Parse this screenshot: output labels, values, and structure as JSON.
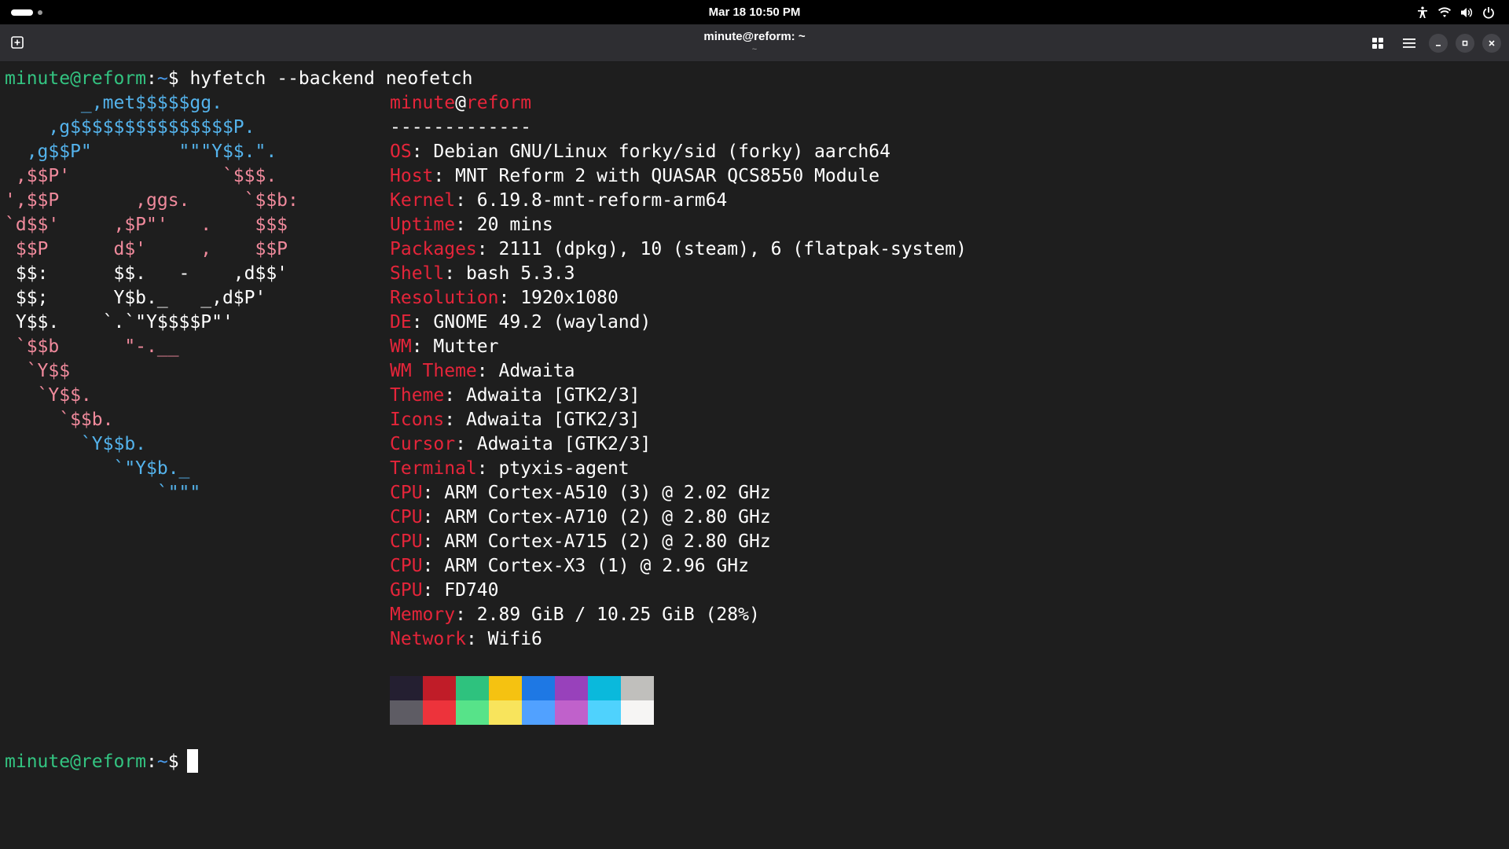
{
  "topbar": {
    "clock": "Mar 18  10:50 PM",
    "tray_icons": [
      "accessibility-icon",
      "wifi-icon",
      "volume-icon",
      "power-icon"
    ]
  },
  "headerbar": {
    "title": "minute@reform: ~",
    "subtitle": "~",
    "buttons": [
      "new-tab-icon",
      "tab-overview-icon",
      "menu-icon",
      "minimize-icon",
      "maximize-icon",
      "close-icon"
    ]
  },
  "terminal": {
    "prompt_user_host": "minute@reform",
    "prompt_colon": ":",
    "prompt_path": "~",
    "prompt_dollar": "$",
    "command": " hyfetch --backend neofetch",
    "ascii_art": [
      {
        "segs": [
          {
            "t": "       _,met$$$$$gg.",
            "c": "cyan"
          }
        ]
      },
      {
        "segs": [
          {
            "t": "    ,g$$$$$$$$$$$$$$$P.",
            "c": "cyan"
          }
        ]
      },
      {
        "segs": [
          {
            "t": "  ,g$$P\"        \"\"\"Y$$.\".",
            "c": "cyan"
          }
        ]
      },
      {
        "segs": [
          {
            "t": " ,$$P'              `$$$.",
            "c": "pink"
          }
        ]
      },
      {
        "segs": [
          {
            "t": "',$$P       ,ggs.     `$$b:",
            "c": "pink"
          }
        ]
      },
      {
        "segs": [
          {
            "t": "`d$$'     ,$P\"'   .    $$$",
            "c": "pink"
          }
        ]
      },
      {
        "segs": [
          {
            "t": " $$P      d$'     ,    $$P",
            "c": "pink"
          }
        ]
      },
      {
        "segs": [
          {
            "t": " $$:      $$.   -    ,d$$'",
            "c": "white"
          }
        ]
      },
      {
        "segs": [
          {
            "t": " $$;      Y$b._   _,d$P'",
            "c": "white"
          }
        ]
      },
      {
        "segs": [
          {
            "t": " Y$$.    `.`\"Y$$$$P\"'",
            "c": "white"
          }
        ]
      },
      {
        "segs": [
          {
            "t": " `$$b      \"-.__",
            "c": "pink"
          }
        ]
      },
      {
        "segs": [
          {
            "t": "  `Y$$",
            "c": "pink"
          }
        ]
      },
      {
        "segs": [
          {
            "t": "   `Y$$.",
            "c": "pink"
          }
        ]
      },
      {
        "segs": [
          {
            "t": "     `$$b.",
            "c": "pink"
          }
        ]
      },
      {
        "segs": [
          {
            "t": "       `Y$$b.",
            "c": "cyan"
          }
        ]
      },
      {
        "segs": [
          {
            "t": "          `\"Y$b._",
            "c": "cyan"
          }
        ]
      },
      {
        "segs": [
          {
            "t": "              `\"\"\"",
            "c": "cyan"
          }
        ]
      }
    ],
    "info_user": "minute",
    "info_at": "@",
    "info_host": "reform",
    "info_separator": "-------------",
    "info": [
      {
        "key": "OS",
        "value": "Debian GNU/Linux forky/sid (forky) aarch64"
      },
      {
        "key": "Host",
        "value": "MNT Reform 2 with QUASAR QCS8550 Module"
      },
      {
        "key": "Kernel",
        "value": "6.19.8-mnt-reform-arm64"
      },
      {
        "key": "Uptime",
        "value": "20 mins"
      },
      {
        "key": "Packages",
        "value": "2111 (dpkg), 10 (steam), 6 (flatpak-system)"
      },
      {
        "key": "Shell",
        "value": "bash 5.3.3"
      },
      {
        "key": "Resolution",
        "value": "1920x1080"
      },
      {
        "key": "DE",
        "value": "GNOME 49.2 (wayland)"
      },
      {
        "key": "WM",
        "value": "Mutter"
      },
      {
        "key": "WM Theme",
        "value": "Adwaita"
      },
      {
        "key": "Theme",
        "value": "Adwaita [GTK2/3]"
      },
      {
        "key": "Icons",
        "value": "Adwaita [GTK2/3]"
      },
      {
        "key": "Cursor",
        "value": "Adwaita [GTK2/3]"
      },
      {
        "key": "Terminal",
        "value": "ptyxis-agent"
      },
      {
        "key": "CPU",
        "value": "ARM Cortex-A510 (3) @ 2.02 GHz"
      },
      {
        "key": "CPU",
        "value": "ARM Cortex-A710 (2) @ 2.80 GHz"
      },
      {
        "key": "CPU",
        "value": "ARM Cortex-A715 (2) @ 2.80 GHz"
      },
      {
        "key": "CPU",
        "value": "ARM Cortex-X3 (1) @ 2.96 GHz"
      },
      {
        "key": "GPU",
        "value": "FD740"
      },
      {
        "key": "Memory",
        "value": "2.89 GiB / 10.25 GiB (28%)"
      },
      {
        "key": "Network",
        "value": "Wifi6"
      }
    ],
    "palette_normal": [
      "#241f31",
      "#c01c28",
      "#2ec27e",
      "#f5c211",
      "#1e78e4",
      "#9841bb",
      "#0ab9dc",
      "#c0bfbc"
    ],
    "palette_bright": [
      "#5e5c64",
      "#ed333b",
      "#57e389",
      "#f8e45c",
      "#51a1ff",
      "#c061cb",
      "#4fd2fd",
      "#f6f5f4"
    ]
  }
}
